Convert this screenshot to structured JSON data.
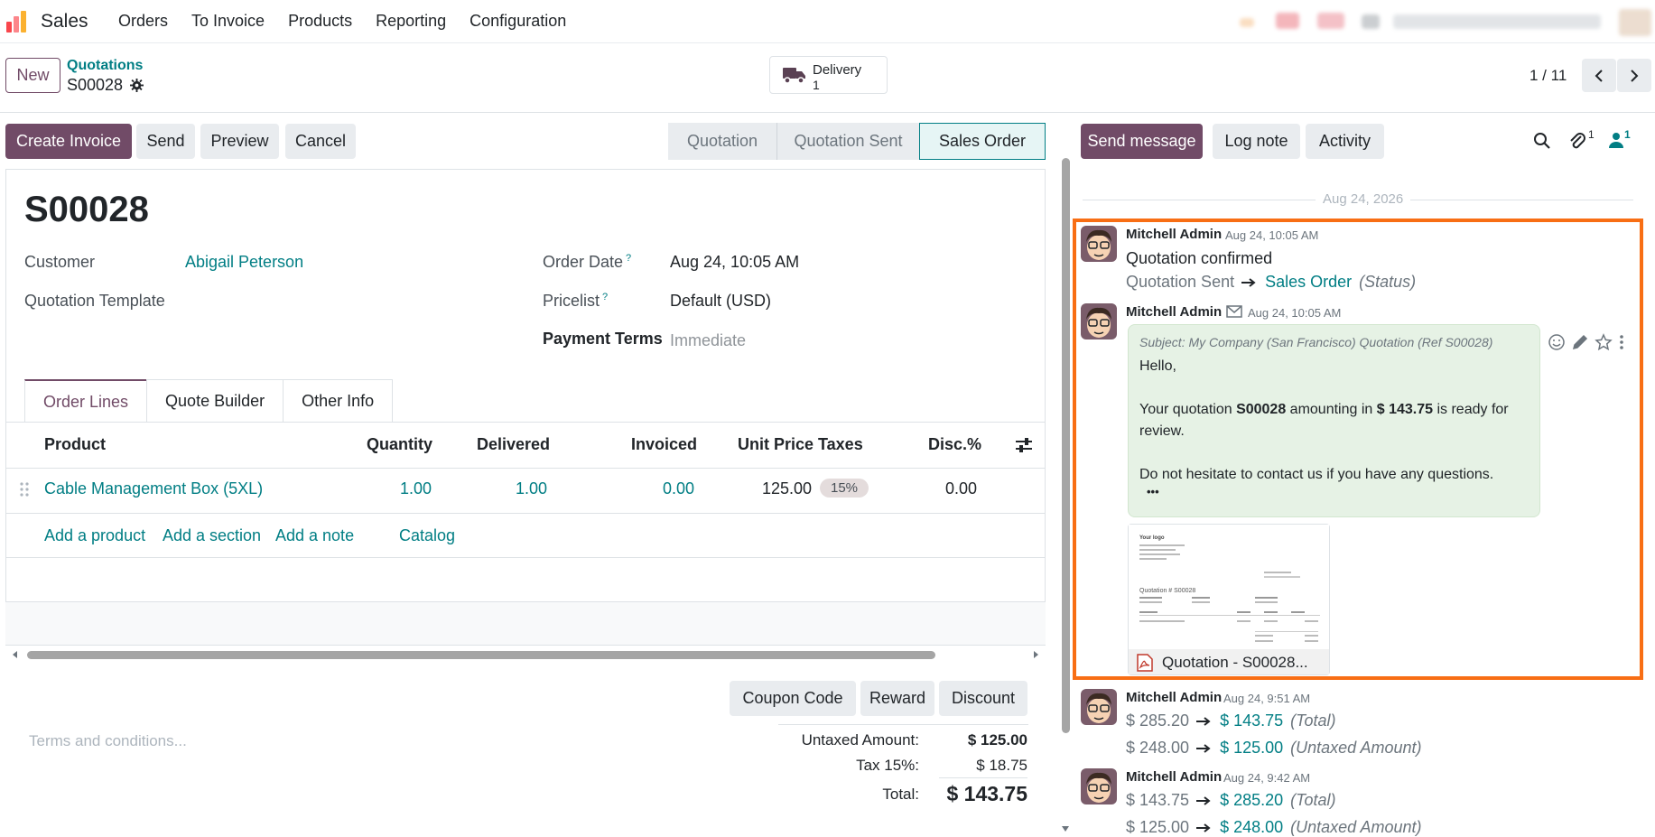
{
  "navbar": {
    "app_name": "Sales",
    "menu": [
      "Orders",
      "To Invoice",
      "Products",
      "Reporting",
      "Configuration"
    ]
  },
  "control_panel": {
    "new_label": "New",
    "breadcrumb": "Quotations",
    "record": "S00028",
    "smart_button": {
      "label": "Delivery",
      "value": "1"
    },
    "pager": "1 / 11"
  },
  "actions": {
    "create_invoice": "Create Invoice",
    "send": "Send",
    "preview": "Preview",
    "cancel": "Cancel"
  },
  "stages": [
    "Quotation",
    "Quotation Sent",
    "Sales Order"
  ],
  "active_stage": "Sales Order",
  "form": {
    "title": "S00028",
    "customer_label": "Customer",
    "customer": "Abigail Peterson",
    "template_label": "Quotation Template",
    "order_date_label": "Order Date",
    "order_date": "Aug 24, 10:05 AM",
    "pricelist_label": "Pricelist",
    "pricelist": "Default (USD)",
    "payment_terms_label": "Payment Terms",
    "payment_terms": "Immediate",
    "help_mark": "?"
  },
  "tabs": [
    "Order Lines",
    "Quote Builder",
    "Other Info"
  ],
  "order_lines": {
    "headers": [
      "Product",
      "Quantity",
      "Delivered",
      "Invoiced",
      "Unit Price",
      "Taxes",
      "Disc.%"
    ],
    "rows": [
      {
        "product": "Cable Management Box (5XL)",
        "quantity": "1.00",
        "delivered": "1.00",
        "invoiced": "0.00",
        "unit_price": "125.00",
        "taxes": "15%",
        "discount": "0.00"
      }
    ],
    "add_links": [
      "Add a product",
      "Add a section",
      "Add a note",
      "Catalog"
    ]
  },
  "promo_buttons": [
    "Coupon Code",
    "Reward",
    "Discount"
  ],
  "terms_placeholder": "Terms and conditions...",
  "totals": {
    "untaxed_label": "Untaxed Amount:",
    "untaxed": "$ 125.00",
    "tax_label": "Tax 15%:",
    "tax": "$ 18.75",
    "total_label": "Total:",
    "total": "$ 143.75"
  },
  "chatter": {
    "send_message": "Send message",
    "log_note": "Log note",
    "activity": "Activity",
    "attachments_count": "1",
    "followers_count": "1",
    "date_separator": "Aug 24, 2026",
    "messages": [
      {
        "author": "Mitchell Admin",
        "date": "Aug 24, 10:05 AM",
        "body": "Quotation confirmed",
        "tracking": {
          "old": "Quotation Sent",
          "new": "Sales Order",
          "field": "(Status)"
        }
      },
      {
        "author": "Mitchell Admin",
        "date": "Aug 24, 10:05 AM",
        "subject": "Subject: My Company (San Francisco) Quotation (Ref S00028)",
        "greeting": "Hello,",
        "line1_pre": "Your quotation ",
        "line1_ref": "S00028",
        "line1_mid": " amounting in ",
        "line1_amount": "$ 143.75",
        "line1_post": " is ready for",
        "line2": "review.",
        "line3": "Do not hesitate to contact us if you have any questions.",
        "more": "•••",
        "attachment": "Quotation - S00028..."
      },
      {
        "author": "Mitchell Admin",
        "date": "Aug 24, 9:51 AM",
        "tracking": [
          {
            "old": "$ 285.20",
            "new": "$ 143.75",
            "field": "(Total)"
          },
          {
            "old": "$ 248.00",
            "new": "$ 125.00",
            "field": "(Untaxed Amount)"
          }
        ]
      },
      {
        "author": "Mitchell Admin",
        "date": "Aug 24, 9:42 AM",
        "tracking": [
          {
            "old": "$ 143.75",
            "new": "$ 285.20",
            "field": "(Total)"
          },
          {
            "old": "$ 125.00",
            "new": "$ 248.00",
            "field": "(Untaxed Amount)"
          }
        ]
      }
    ]
  },
  "preview_doc": {
    "logo": "Your logo",
    "heading": "Quotation # S00028"
  },
  "colors": {
    "primary": "#714B67",
    "link": "#017e84",
    "highlight": "#f86e14"
  }
}
